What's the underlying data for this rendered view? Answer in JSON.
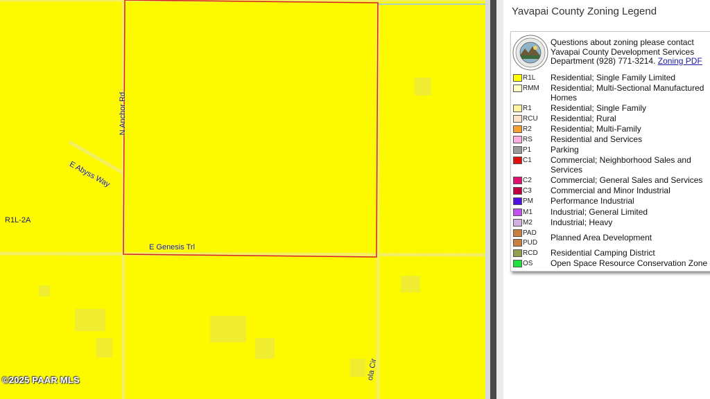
{
  "map": {
    "road_labels": {
      "anchor": "N Anchor Rd",
      "abyss": "E Abyss Way",
      "genesis": "E Genesis Trl",
      "partial": "ola Cir"
    },
    "zone_label": "R1L-2A",
    "copyright": "©2025 PAAR MLS",
    "colors": {
      "zone_fill": "#fdfa00",
      "parcel_outline": "#d42020",
      "roads": "#f0ef70"
    }
  },
  "legend": {
    "title": "Yavapai County Zoning Legend",
    "intro": "Questions about zoning please contact Yavapai County Development Services Department (928) 771-3214.",
    "link": "Zoning PDF",
    "seal_icon": "county-seal-icon",
    "rows": [
      {
        "codes": [
          "R1L"
        ],
        "color": "#ffff00",
        "desc": "Residential; Single Family Limited"
      },
      {
        "codes": [
          "RMM"
        ],
        "color": "#ffffc8",
        "desc": "Residential; Multi-Sectional Manufactured Homes"
      },
      {
        "codes": [
          "R1"
        ],
        "color": "#fff2a0",
        "desc": "Residential; Single Family"
      },
      {
        "codes": [
          "RCU"
        ],
        "color": "#fde4c8",
        "desc": "Residential; Rural"
      },
      {
        "codes": [
          "R2"
        ],
        "color": "#f5a030",
        "desc": "Residential; Multi-Family"
      },
      {
        "codes": [
          "RS"
        ],
        "color": "#ffb0e0",
        "desc": "Residential and Services"
      },
      {
        "codes": [
          "P1"
        ],
        "color": "#9a9a9a",
        "desc": "Parking"
      },
      {
        "codes": [
          "C1"
        ],
        "color": "#e01010",
        "desc": "Commercial; Neighborhood Sales and Services"
      },
      {
        "codes": [
          "C2"
        ],
        "color": "#e01070",
        "desc": "Commercial; General Sales and Services"
      },
      {
        "codes": [
          "C3"
        ],
        "color": "#c00040",
        "desc": "Commercial and Minor Industrial"
      },
      {
        "codes": [
          "PM"
        ],
        "color": "#5010e0",
        "desc": "Performance Industrial"
      },
      {
        "codes": [
          "M1"
        ],
        "color": "#c050f0",
        "desc": "Industrial; General Limited"
      },
      {
        "codes": [
          "M2"
        ],
        "color": "#d0b0e0",
        "desc": "Industrial; Heavy"
      },
      {
        "codes": [
          "PAD",
          "PUD"
        ],
        "color": "#c88040",
        "desc": "Planned Area Development"
      },
      {
        "codes": [
          "RCD"
        ],
        "color": "#90a050",
        "desc": "Residential Camping District"
      },
      {
        "codes": [
          "OS"
        ],
        "color": "#20e040",
        "desc": "Open Space Resource Conservation Zone"
      }
    ]
  }
}
